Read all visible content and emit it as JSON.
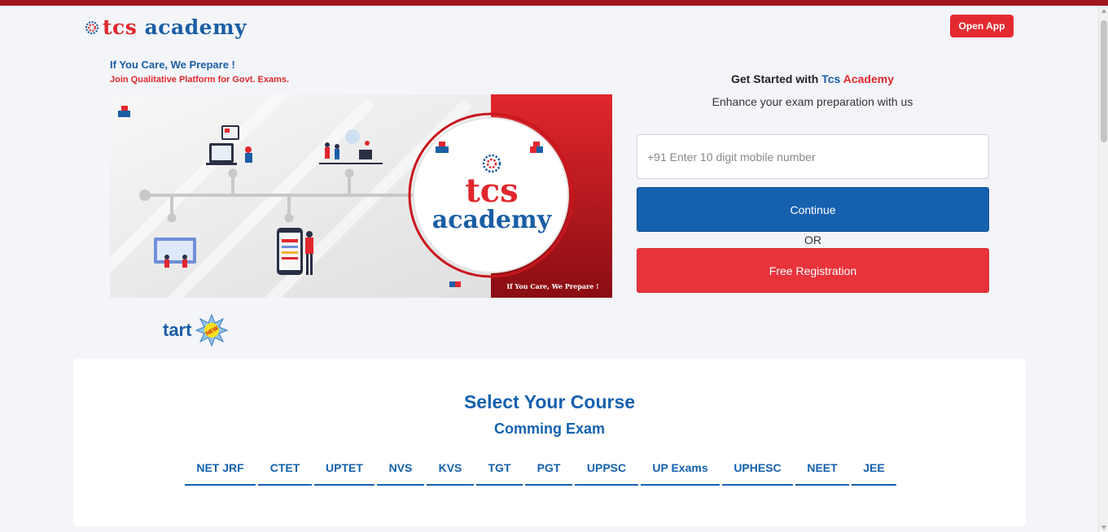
{
  "header": {
    "logo_text_1": "tcs",
    "logo_text_2": "academy",
    "open_app_label": "Open App"
  },
  "hero": {
    "tagline": "If You Care, We Prepare !",
    "subtagline": "Join Qualitative Platform for Govt. Exams.",
    "banner": {
      "logo_text_1": "tcs",
      "logo_text_2": "academy",
      "caption": "If You Care, We Prepare !"
    },
    "marquee_text": "tart",
    "new_badge": "NEW"
  },
  "signup": {
    "title_prefix": "Get Started with",
    "title_brand_1": "Tcs",
    "title_brand_2": "Academy",
    "subtitle": "Enhance your exam preparation with us",
    "mobile_placeholder": "+91 Enter 10 digit mobile number",
    "continue_label": "Continue",
    "or_label": "OR",
    "free_registration_label": "Free Registration"
  },
  "courses": {
    "title": "Select Your Course",
    "subtitle": "Comming Exam",
    "tabs": [
      {
        "label": "NET JRF"
      },
      {
        "label": "CTET"
      },
      {
        "label": "UPTET"
      },
      {
        "label": "NVS"
      },
      {
        "label": "KVS"
      },
      {
        "label": "TGT"
      },
      {
        "label": "PGT"
      },
      {
        "label": "UPPSC"
      },
      {
        "label": "UP Exams"
      },
      {
        "label": "UPHESC"
      },
      {
        "label": "NEET"
      },
      {
        "label": "JEE"
      }
    ]
  },
  "colors": {
    "brand_red": "#e1272d",
    "brand_blue": "#1a5ea6",
    "button_blue": "#1561ae",
    "button_red": "#e8333b"
  }
}
